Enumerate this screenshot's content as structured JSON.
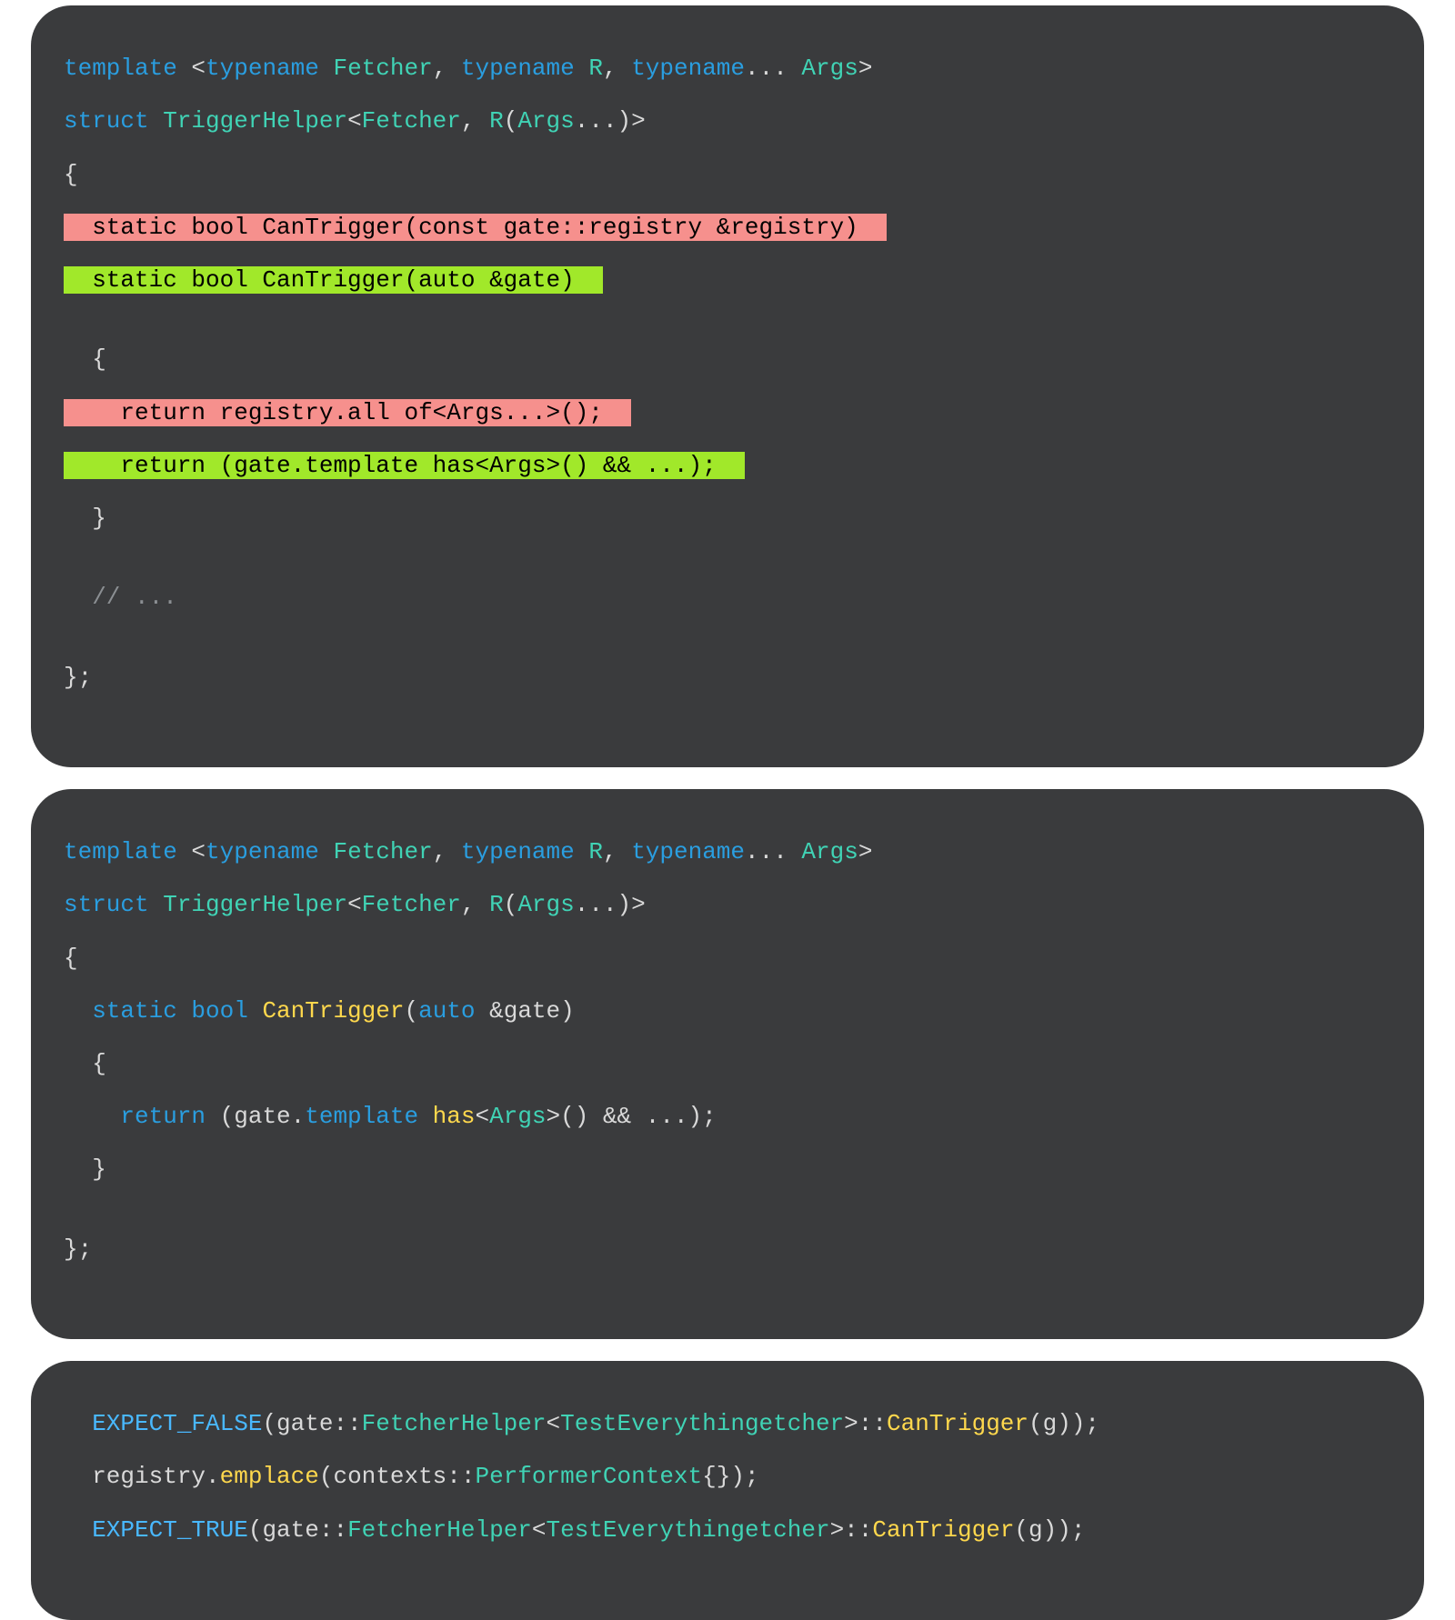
{
  "panels": {
    "p1": {
      "l1_template": "template",
      "l1_typename1": "typename",
      "l1_Fetcher": " Fetcher",
      "l1_typename2": "typename",
      "l1_R": " R",
      "l1_typename3": "typename",
      "l1_Args": " Args",
      "l2_struct": "struct",
      "l2_TriggerHelper": " TriggerHelper",
      "l2_Fetcher2": "Fetcher",
      "l2_R2": "R",
      "l2_Args2": "Args",
      "l3_open": "{",
      "l4_del": "  static bool CanTrigger(const gate::registry &registry)  ",
      "l5_add": "  static bool CanTrigger(auto &gate)  ",
      "l6_blank": "",
      "l7": "  {",
      "l8_del": "    return registry.all of<Args...>();  ",
      "l9_add": "    return (gate.template has<Args>() && ...);  ",
      "l10": "  }",
      "l11_blank": "",
      "l12_comment": "  // ...",
      "l13_blank": "",
      "l14_close": "};"
    },
    "p2": {
      "l1_template": "template",
      "l1_typename1": "typename",
      "l1_Fetcher": " Fetcher",
      "l1_typename2": "typename",
      "l1_R": " R",
      "l1_typename3": "typename",
      "l1_Args": " Args",
      "l2_struct": "struct",
      "l2_TriggerHelper": " TriggerHelper",
      "l2_Fetcher2": "Fetcher",
      "l2_R2": "R",
      "l2_Args2": "Args",
      "l3_open": "{",
      "l4_static": "  static",
      "l4_bool": " bool",
      "l4_fn": " CanTrigger",
      "l4_auto": "auto",
      "l4_gate": " &gate)",
      "l5": "  {",
      "l6_return": "    return",
      "l6_expr_a": " (gate.",
      "l6_template": "template",
      "l6_has": " has",
      "l6_Args": "Args",
      "l6_tail": ">() && ...);",
      "l7": "  }",
      "l8_blank": "",
      "l9_close": "};"
    },
    "p3": {
      "l1_macro": "  EXPECT_FALSE",
      "l1_a": "(gate::",
      "l1_FetcherHelper": "FetcherHelper",
      "l1_TE": "TestEverythingetcher",
      "l1_mid": ">::",
      "l1_CT": "CanTrigger",
      "l1_end": "(g));",
      "l2_a": "  registry.",
      "l2_emplace": "emplace",
      "l2_b": "(contexts::",
      "l2_PC": "PerformerContext",
      "l2_end": "{});",
      "l3_macro": "  EXPECT_TRUE",
      "l3_a": "(gate::",
      "l3_FetcherHelper": "FetcherHelper",
      "l3_TE": "TestEverythingetcher",
      "l3_mid": ">::",
      "l3_CT": "CanTrigger",
      "l3_end": "(g));"
    }
  }
}
